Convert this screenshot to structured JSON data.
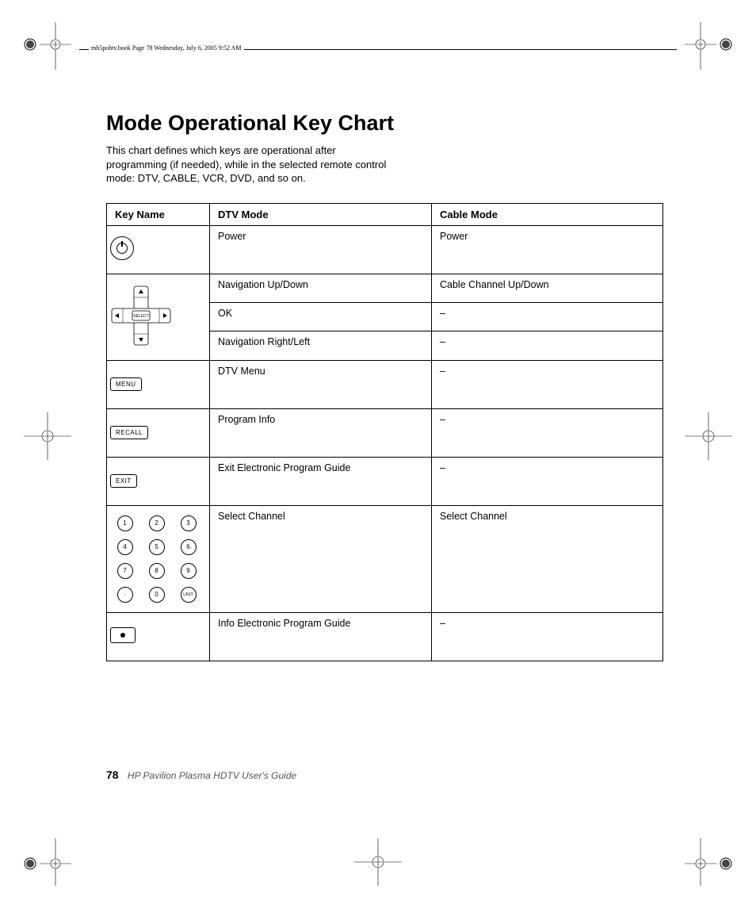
{
  "header_text": "mh5pohtv.book  Page 78  Wednesday, July 6, 2005  9:52 AM",
  "title": "Mode Operational Key Chart",
  "intro": "This chart defines which keys are operational after programming (if needed), while in the selected remote control mode: DTV, CABLE, VCR, DVD, and so on.",
  "columns": {
    "c1": "Key Name",
    "c2": "DTV Mode",
    "c3": "Cable Mode"
  },
  "rows": {
    "power": {
      "icon": "power",
      "dtv": "Power",
      "cable": "Power"
    },
    "nav_ud": {
      "dtv": "Navigation Up/Down",
      "cable": "Cable Channel Up/Down"
    },
    "nav_ok": {
      "dtv": "OK",
      "cable": "–"
    },
    "nav_rl": {
      "dtv": "Navigation Right/Left",
      "cable": "–"
    },
    "menu": {
      "label": "MENU",
      "dtv": "DTV Menu",
      "cable": "–"
    },
    "recall": {
      "label": "RECALL",
      "dtv": "Program Info",
      "cable": "–"
    },
    "exit": {
      "label": "EXIT",
      "dtv": "Exit Electronic Program Guide",
      "cable": "–"
    },
    "keypad": {
      "keys": [
        "1",
        "2",
        "3",
        "4",
        "5",
        "6",
        "7",
        "8",
        "9",
        "·",
        "0",
        "LAST"
      ],
      "dtv": "Select Channel",
      "cable": "Select Channel"
    },
    "info": {
      "dtv": "Info Electronic Program Guide",
      "cable": "–"
    }
  },
  "dpad_select_label": "SELECT",
  "footer": {
    "page": "78",
    "guide": "HP Pavilion Plasma HDTV User's Guide"
  }
}
